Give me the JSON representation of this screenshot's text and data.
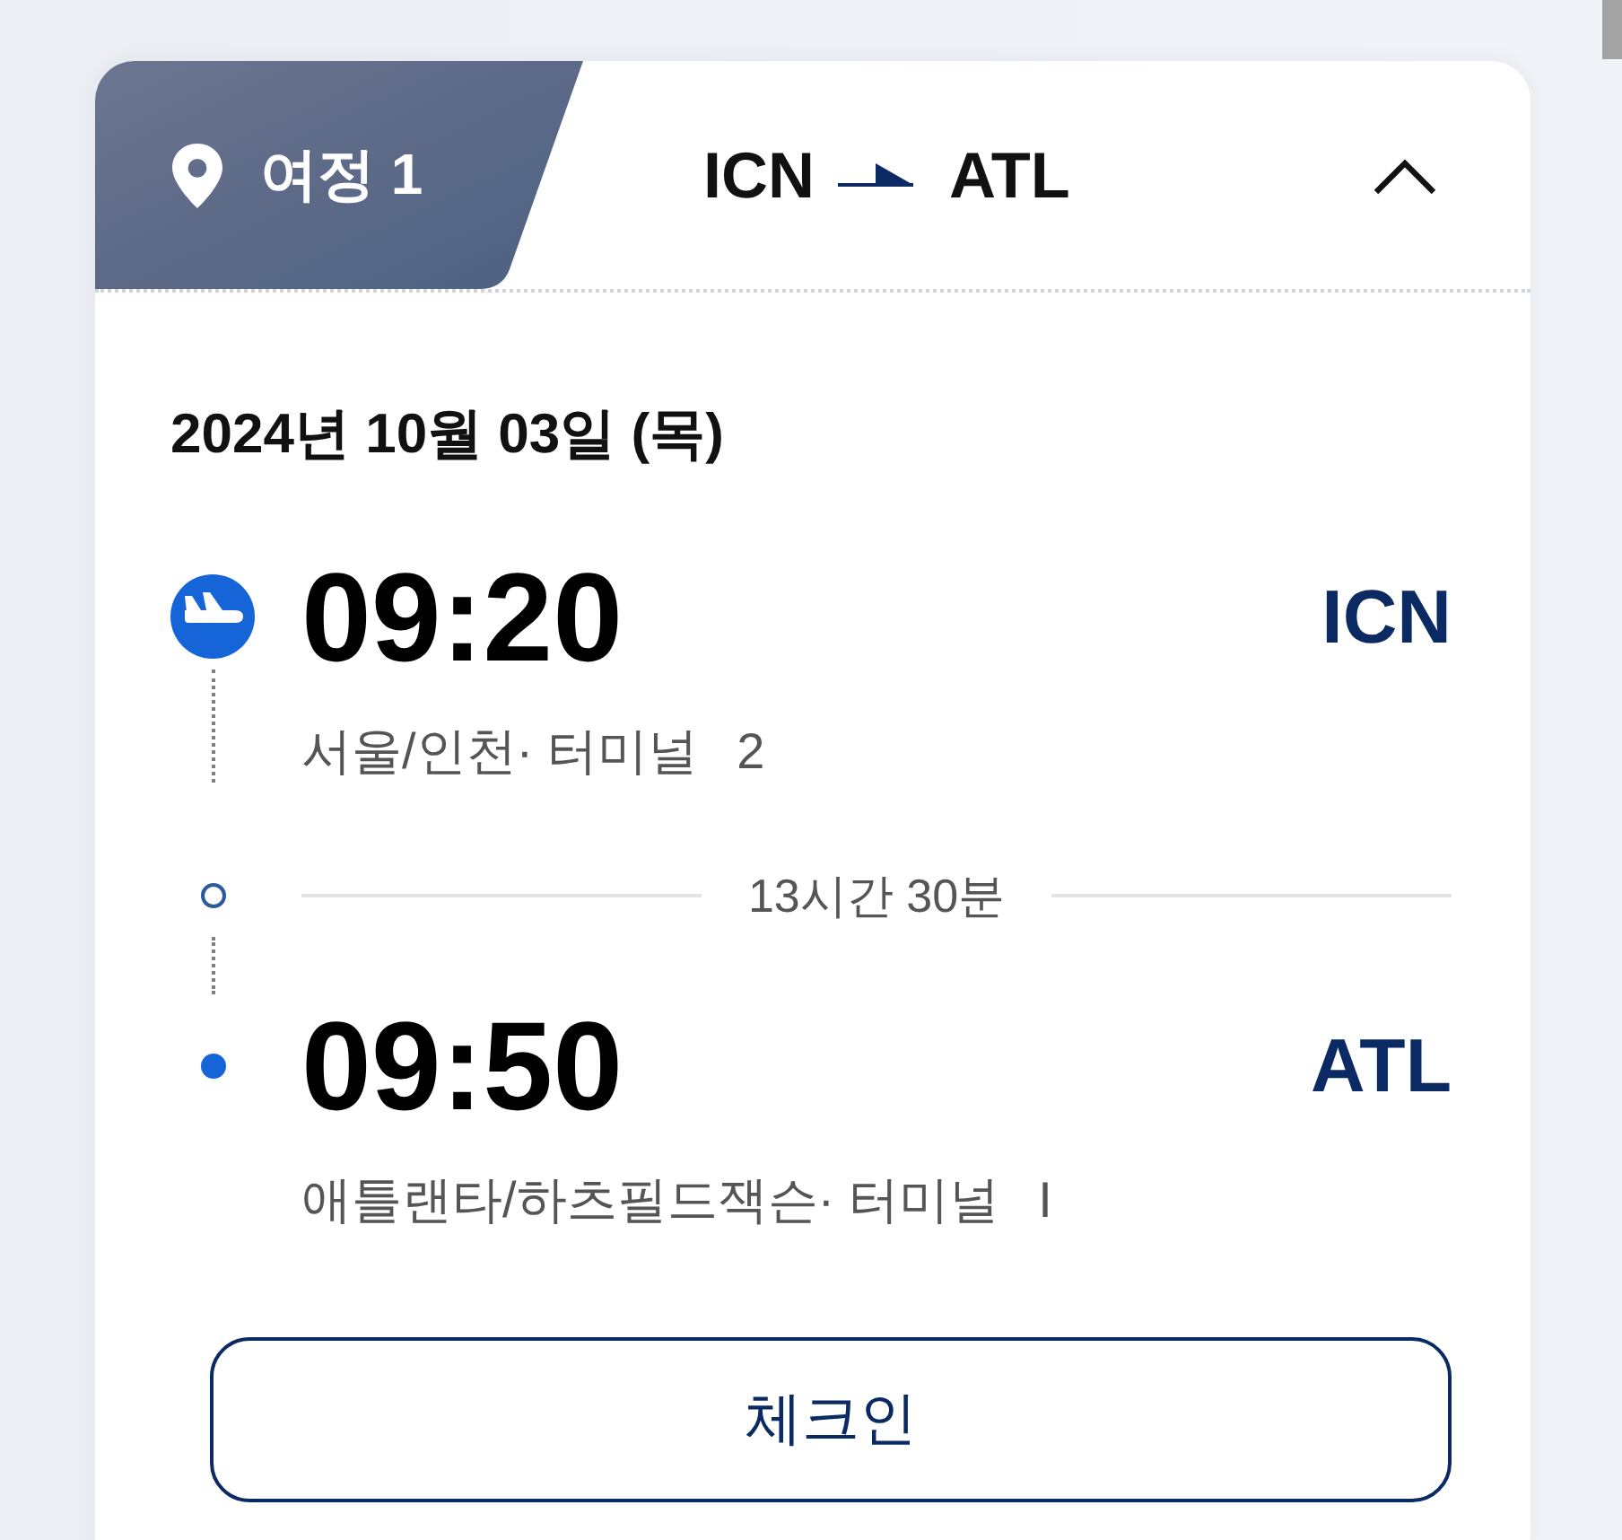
{
  "itinerary": {
    "tab_label": "여정 1",
    "route": {
      "origin": "ICN",
      "destination": "ATL"
    },
    "expanded": true,
    "date": "2024년 10월 03일 (목)",
    "segments": [
      {
        "kind": "departure",
        "time": "09:20",
        "airport_code": "ICN",
        "location": "서울/인천· 터미널",
        "terminal": "2"
      },
      {
        "kind": "arrival",
        "time": "09:50",
        "airport_code": "ATL",
        "location": "애틀랜타/하츠필드잭슨· 터미널",
        "terminal": "I"
      }
    ],
    "duration": "13시간 30분",
    "checkin_button": "체크인"
  }
}
